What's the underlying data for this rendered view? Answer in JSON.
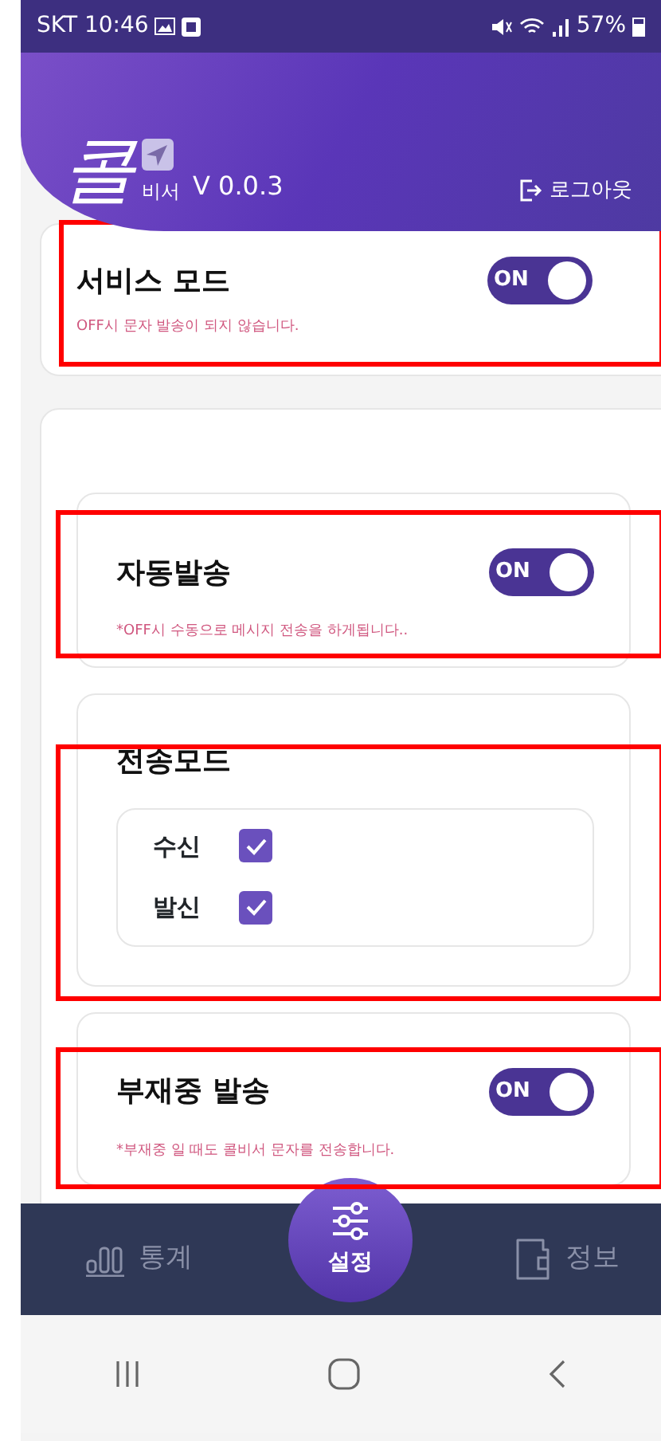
{
  "status_bar": {
    "carrier_time": "SKT 10:46",
    "battery": "57%"
  },
  "header": {
    "logo_text": "콜",
    "logo_subtext": "비서",
    "version": "V 0.0.3",
    "logout": "로그아웃"
  },
  "service_mode": {
    "title": "서비스 모드",
    "on": true,
    "toggle_label": "ON",
    "note": "OFF시 문자 발송이 되지 않습니다."
  },
  "settings": [
    {
      "kind": "toggle",
      "title": "자동발송",
      "on": true,
      "toggle_label": "ON",
      "note": "*OFF시 수동으로 메시지 전송을 하게됩니다.."
    },
    {
      "kind": "checklist",
      "title": "전송모드",
      "options": [
        {
          "label": "수신",
          "checked": true
        },
        {
          "label": "발신",
          "checked": true
        }
      ]
    },
    {
      "kind": "toggle",
      "title": "부재중 발송",
      "on": true,
      "toggle_label": "ON",
      "note": "*부재중 일 때도 콜비서 문자를 전송합니다."
    }
  ],
  "bottom_nav": [
    {
      "kind": "stats",
      "label": "통계",
      "selected": false
    },
    {
      "kind": "settings",
      "label": "설정",
      "selected": true
    },
    {
      "kind": "wallet",
      "label": "정보",
      "selected": false
    }
  ]
}
